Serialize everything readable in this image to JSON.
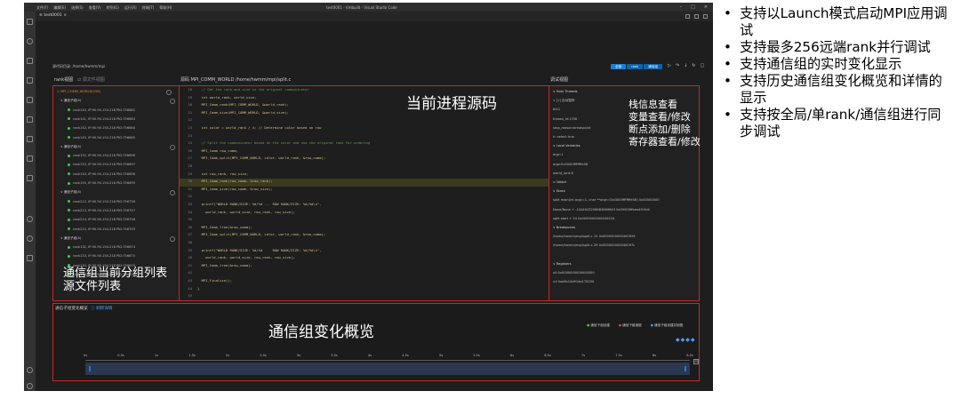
{
  "window": {
    "title": "test0001 - Vmbuild - Visual Studio Code",
    "menu": [
      "文件(F)",
      "编辑(E)",
      "选择(S)",
      "查看(V)",
      "转到(G)",
      "运行(R)",
      "终端(T)",
      "帮助(H)"
    ],
    "tab_label": "test0001"
  },
  "path_label": "源代码目录: /home/hwmm/mpi",
  "parallel_buttons": [
    "全部",
    "rank",
    "通信组"
  ],
  "left_panel": {
    "title": "rank视图",
    "search_placeholder": "源文件视图",
    "rows": [
      {
        "text": "MPI_COMM_WORLD(256)",
        "kind": "sel"
      },
      {
        "text": "通信子组(4)",
        "kind": "grp"
      },
      {
        "text": "rank140, IP:90.90.154.218 PID:756682",
        "kind": "item"
      },
      {
        "text": "rank141, IP:90.90.154.218 PID:756683",
        "kind": "item"
      },
      {
        "text": "rank142, IP:90.90.154.218 PID:756684",
        "kind": "item"
      },
      {
        "text": "rank143, IP:90.90.154.218 PID:756685",
        "kind": "item"
      },
      {
        "text": "通信子组(4)",
        "kind": "grp"
      },
      {
        "text": "rank152, IP:90.90.154.218 PID:756696",
        "kind": "item"
      },
      {
        "text": "rank153, IP:90.90.154.218 PID:756697",
        "kind": "item"
      },
      {
        "text": "rank154, IP:90.90.154.218 PID:756698",
        "kind": "item"
      },
      {
        "text": "rank155, IP:90.90.154.218 PID:756699",
        "kind": "item"
      },
      {
        "text": "通信子组(4)",
        "kind": "grp"
      },
      {
        "text": "rank212, IP:90.90.154.218 PID:756756",
        "kind": "item"
      },
      {
        "text": "rank213, IP:90.90.154.218 PID:756757",
        "kind": "item"
      },
      {
        "text": "rank214, IP:90.90.154.218 PID:756758",
        "kind": "item"
      },
      {
        "text": "rank215, IP:90.90.154.218 PID:756759",
        "kind": "item"
      },
      {
        "text": "通信子组(4)",
        "kind": "grp"
      },
      {
        "text": "rank132, IP:90.90.154.218 PID:756674",
        "kind": "item"
      },
      {
        "text": "rank133, IP:90.90.154.218 PID:756675",
        "kind": "item"
      },
      {
        "text": "rank134, IP:90.90.154.218 PID:756676",
        "kind": "item"
      },
      {
        "text": "rank135, IP:90.90.154.218 PID:756677",
        "kind": "item"
      }
    ]
  },
  "editor": {
    "title": "源码 MPI_COMM_WORLD /home/hwmm/mpi/split.c",
    "lines": [
      {
        "n": "18",
        "t": "  // Get the rank and size in the original communicator",
        "c": "cm"
      },
      {
        "n": "19",
        "t": "  int world_rank, world_size;",
        "c": "cd"
      },
      {
        "n": "20",
        "t": "  MPI_Comm_rank(MPI_COMM_WORLD, &world_rank);",
        "c": "cd"
      },
      {
        "n": "21",
        "t": "  MPI_Comm_size(MPI_COMM_WORLD, &world_size);",
        "c": "cd"
      },
      {
        "n": "22",
        "t": "",
        "c": "cd"
      },
      {
        "n": "23",
        "t": "  int color = world_rank / 4; // Determine color based on row",
        "c": "cd"
      },
      {
        "n": "24",
        "t": "",
        "c": "cd"
      },
      {
        "n": "25",
        "t": "  // Split the communicator based on the color and use the original rank for ordering",
        "c": "cm"
      },
      {
        "n": "26",
        "t": "  MPI_Comm row_comm;",
        "c": "cd"
      },
      {
        "n": "27",
        "t": "  MPI_Comm_split(MPI_COMM_WORLD, color, world_rank, &row_comm);",
        "c": "cd"
      },
      {
        "n": "28",
        "t": "",
        "c": "cd"
      },
      {
        "n": "29",
        "t": "  int row_rank, row_size;",
        "c": "cd"
      },
      {
        "n": "30",
        "t": "  MPI_Comm_rank(row_comm, &row_rank);",
        "c": "hl"
      },
      {
        "n": "31",
        "t": "  MPI_Comm_size(row_comm, &row_size);",
        "c": "cd"
      },
      {
        "n": "32",
        "t": "",
        "c": "cd"
      },
      {
        "n": "33",
        "t": "  printf(\"WORLD RANK/SIZE: %d/%d --- ROW RANK/SIZE: %d/%d\\n\",",
        "c": "cd"
      },
      {
        "n": "34",
        "t": "    world_rank, world_size, row_rank, row_size);",
        "c": "cd"
      },
      {
        "n": "35",
        "t": "",
        "c": "cd"
      },
      {
        "n": "36",
        "t": "  MPI_Comm_free(&row_comm);",
        "c": "cd"
      },
      {
        "n": "37",
        "t": "  MPI_Comm_split(MPI_COMM_WORLD, color, world_rank, &row_comm);",
        "c": "cd"
      },
      {
        "n": "38",
        "t": "",
        "c": "cd"
      },
      {
        "n": "39",
        "t": "  printf(\"WORLD RANK/SIZE: %d/%d     ROW RANK/SIZE: %d/%d\\n\",",
        "c": "cd"
      },
      {
        "n": "40",
        "t": "    world_rank, world_size, row_rank, row_size);",
        "c": "cd"
      },
      {
        "n": "41",
        "t": "  MPI_Comm_free(&row_comm);",
        "c": "cd"
      },
      {
        "n": "42",
        "t": "",
        "c": "cd"
      },
      {
        "n": "43",
        "t": "  MPI_Finalize();",
        "c": "cd"
      },
      {
        "n": "44",
        "t": "}",
        "c": "cd"
      },
      {
        "n": "45",
        "t": "",
        "c": "cd"
      }
    ]
  },
  "debug_panel": {
    "title": "调试视图",
    "rows": [
      {
        "text": "∨ Host Threads",
        "kind": "sec"
      },
      {
        "text": "  ∨ [1] 自动暂停",
        "kind": "v"
      },
      {
        "text": "      tid:1",
        "kind": "v"
      },
      {
        "text": "      thread_id:1706",
        "kind": "v"
      },
      {
        "text": "      stop_reason:breakpoint",
        "kind": "v"
      },
      {
        "text": "      lr: select true",
        "kind": "v"
      },
      {
        "text": "∨ Local Variables",
        "kind": "sec"
      },
      {
        "text": "    argc:1",
        "kind": "v"
      },
      {
        "text": "    argv:0x0000ffffffffe58",
        "kind": "v"
      },
      {
        "text": "    world_rank:0",
        "kind": "v"
      },
      {
        "text": "> Watch",
        "kind": "sec"
      },
      {
        "text": "∨ Stack",
        "kind": "sec"
      },
      {
        "text": "    split main(int argc=1, char **argv=0x0000ffffffffe58) 0x00000000",
        "kind": "v"
      },
      {
        "text": "    None/None + -1044043208683669843 0x00000ffbea4f15d4",
        "kind": "v"
      },
      {
        "text": "    split start + 54 0x0000000000400534",
        "kind": "v"
      },
      {
        "text": "∨ Breakpoints",
        "kind": "sec"
      },
      {
        "text": "    /home/hwmm/mpi/split.c 15 0x0000000000400929",
        "kind": "v"
      },
      {
        "text": "    /home/hwmm/mpi/split.c 29 0x000000000040097c",
        "kind": "v"
      },
      {
        "text": "",
        "kind": "v"
      },
      {
        "text": "∨ Registers",
        "kind": "sec"
      },
      {
        "text": "    x0:0x0000000000000000",
        "kind": "v"
      },
      {
        "text": "    x1:0xe9b10d914e178200",
        "kind": "v"
      }
    ]
  },
  "bottom_panel": {
    "title": "通信子组变化概览",
    "link": "刷新详情",
    "legend": [
      "通信子组创建",
      "通信子组销毁",
      "通信子组创建并销毁"
    ],
    "ticks": [
      "0s",
      "0.5s",
      "1s",
      "1.5s",
      "2s",
      "2.5s",
      "3s",
      "3.5s",
      "4s",
      "4.5s",
      "5s",
      "5.5s",
      "6s",
      "6.5s",
      "7s",
      "7.5s",
      "8s",
      "8.5s"
    ]
  },
  "annotations": {
    "editor": "当前进程源码",
    "debug_1": "栈信息查看",
    "debug_2": "变量查看/修改",
    "debug_3": "断点添加/删除",
    "debug_4": "寄存器查看/修改",
    "left_1": "通信组当前分组列表",
    "left_2": "源文件列表",
    "bottom": "通信组变化概览"
  },
  "bullets": [
    "支持以Launch模式启动MPI应用调试",
    "支持最多256远端rank并行调试",
    "支持通信组的实时变化显示",
    "支持历史通信组变化概览和详情的显示",
    "支持按全局/单rank/通信组进行同步调试"
  ],
  "colors": {
    "accent": "#1a7fd4",
    "highlight_box": "#c62828",
    "dot": "#3ecf4a"
  }
}
